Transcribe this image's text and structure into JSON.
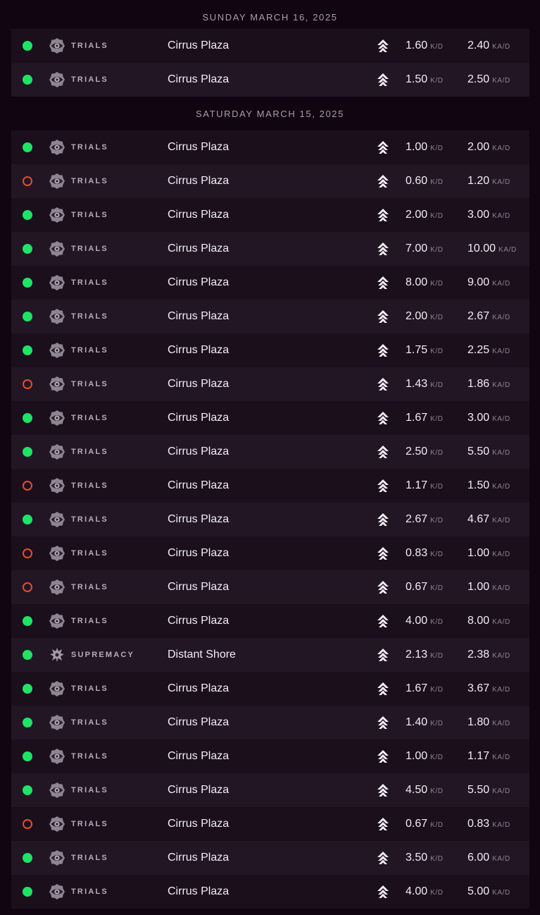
{
  "days": [
    {
      "date": "SUNDAY MARCH 16, 2025",
      "games": [
        {
          "result": "win",
          "mode": "TRIALS",
          "mode_icon": "trials-eye-icon",
          "map": "Cirrus Plaza",
          "class_icon": "hunter-class-icon",
          "kd": "1.60",
          "kad": "2.40"
        },
        {
          "result": "win",
          "mode": "TRIALS",
          "mode_icon": "trials-eye-icon",
          "map": "Cirrus Plaza",
          "class_icon": "hunter-class-icon",
          "kd": "1.50",
          "kad": "2.50"
        }
      ]
    },
    {
      "date": "SATURDAY MARCH 15, 2025",
      "games": [
        {
          "result": "win",
          "mode": "TRIALS",
          "mode_icon": "trials-eye-icon",
          "map": "Cirrus Plaza",
          "class_icon": "hunter-class-icon",
          "kd": "1.00",
          "kad": "2.00"
        },
        {
          "result": "loss",
          "mode": "TRIALS",
          "mode_icon": "trials-eye-icon",
          "map": "Cirrus Plaza",
          "class_icon": "hunter-class-icon",
          "kd": "0.60",
          "kad": "1.20"
        },
        {
          "result": "win",
          "mode": "TRIALS",
          "mode_icon": "trials-eye-icon",
          "map": "Cirrus Plaza",
          "class_icon": "hunter-class-icon",
          "kd": "2.00",
          "kad": "3.00"
        },
        {
          "result": "win",
          "mode": "TRIALS",
          "mode_icon": "trials-eye-icon",
          "map": "Cirrus Plaza",
          "class_icon": "hunter-class-icon",
          "kd": "7.00",
          "kad": "10.00"
        },
        {
          "result": "win",
          "mode": "TRIALS",
          "mode_icon": "trials-eye-icon",
          "map": "Cirrus Plaza",
          "class_icon": "hunter-class-icon",
          "kd": "8.00",
          "kad": "9.00"
        },
        {
          "result": "win",
          "mode": "TRIALS",
          "mode_icon": "trials-eye-icon",
          "map": "Cirrus Plaza",
          "class_icon": "hunter-class-icon",
          "kd": "2.00",
          "kad": "2.67"
        },
        {
          "result": "win",
          "mode": "TRIALS",
          "mode_icon": "trials-eye-icon",
          "map": "Cirrus Plaza",
          "class_icon": "hunter-class-icon",
          "kd": "1.75",
          "kad": "2.25"
        },
        {
          "result": "loss",
          "mode": "TRIALS",
          "mode_icon": "trials-eye-icon",
          "map": "Cirrus Plaza",
          "class_icon": "hunter-class-icon",
          "kd": "1.43",
          "kad": "1.86"
        },
        {
          "result": "win",
          "mode": "TRIALS",
          "mode_icon": "trials-eye-icon",
          "map": "Cirrus Plaza",
          "class_icon": "hunter-class-icon",
          "kd": "1.67",
          "kad": "3.00"
        },
        {
          "result": "win",
          "mode": "TRIALS",
          "mode_icon": "trials-eye-icon",
          "map": "Cirrus Plaza",
          "class_icon": "hunter-class-icon",
          "kd": "2.50",
          "kad": "5.50"
        },
        {
          "result": "loss",
          "mode": "TRIALS",
          "mode_icon": "trials-eye-icon",
          "map": "Cirrus Plaza",
          "class_icon": "hunter-class-icon",
          "kd": "1.17",
          "kad": "1.50"
        },
        {
          "result": "win",
          "mode": "TRIALS",
          "mode_icon": "trials-eye-icon",
          "map": "Cirrus Plaza",
          "class_icon": "hunter-class-icon",
          "kd": "2.67",
          "kad": "4.67"
        },
        {
          "result": "loss",
          "mode": "TRIALS",
          "mode_icon": "trials-eye-icon",
          "map": "Cirrus Plaza",
          "class_icon": "hunter-class-icon",
          "kd": "0.83",
          "kad": "1.00"
        },
        {
          "result": "loss",
          "mode": "TRIALS",
          "mode_icon": "trials-eye-icon",
          "map": "Cirrus Plaza",
          "class_icon": "hunter-class-icon",
          "kd": "0.67",
          "kad": "1.00"
        },
        {
          "result": "win",
          "mode": "TRIALS",
          "mode_icon": "trials-eye-icon",
          "map": "Cirrus Plaza",
          "class_icon": "hunter-class-icon",
          "kd": "4.00",
          "kad": "8.00"
        },
        {
          "result": "win",
          "mode": "SUPREMACY",
          "mode_icon": "supremacy-crest-icon",
          "map": "Distant Shore",
          "class_icon": "hunter-class-icon",
          "kd": "2.13",
          "kad": "2.38"
        },
        {
          "result": "win",
          "mode": "TRIALS",
          "mode_icon": "trials-eye-icon",
          "map": "Cirrus Plaza",
          "class_icon": "hunter-class-icon",
          "kd": "1.67",
          "kad": "3.67"
        },
        {
          "result": "win",
          "mode": "TRIALS",
          "mode_icon": "trials-eye-icon",
          "map": "Cirrus Plaza",
          "class_icon": "hunter-class-icon",
          "kd": "1.40",
          "kad": "1.80"
        },
        {
          "result": "win",
          "mode": "TRIALS",
          "mode_icon": "trials-eye-icon",
          "map": "Cirrus Plaza",
          "class_icon": "hunter-class-icon",
          "kd": "1.00",
          "kad": "1.17"
        },
        {
          "result": "win",
          "mode": "TRIALS",
          "mode_icon": "trials-eye-icon",
          "map": "Cirrus Plaza",
          "class_icon": "hunter-class-icon",
          "kd": "4.50",
          "kad": "5.50"
        },
        {
          "result": "loss",
          "mode": "TRIALS",
          "mode_icon": "trials-eye-icon",
          "map": "Cirrus Plaza",
          "class_icon": "hunter-class-icon",
          "kd": "0.67",
          "kad": "0.83"
        },
        {
          "result": "win",
          "mode": "TRIALS",
          "mode_icon": "trials-eye-icon",
          "map": "Cirrus Plaza",
          "class_icon": "hunter-class-icon",
          "kd": "3.50",
          "kad": "6.00"
        },
        {
          "result": "win",
          "mode": "TRIALS",
          "mode_icon": "trials-eye-icon",
          "map": "Cirrus Plaza",
          "class_icon": "hunter-class-icon",
          "kd": "4.00",
          "kad": "5.00"
        }
      ]
    }
  ],
  "units": {
    "kd": "K/D",
    "kad": "KA/D"
  },
  "colors": {
    "win": "#1ee466",
    "loss": "#e94b2b",
    "background": "#100510"
  }
}
